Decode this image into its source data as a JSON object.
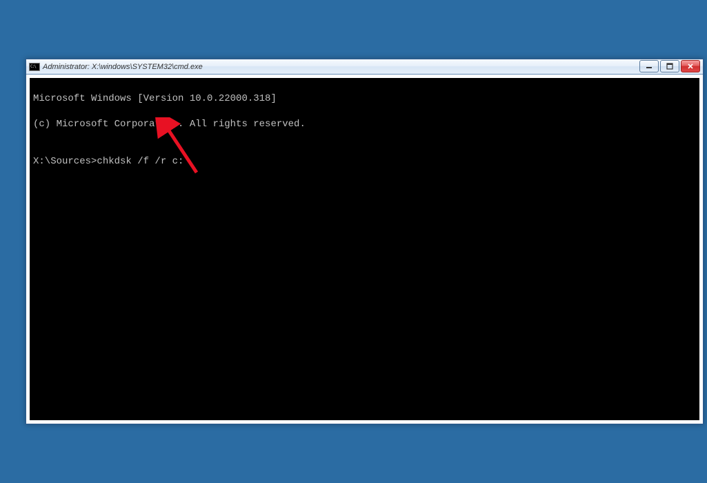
{
  "window": {
    "title": "Administrator: X:\\windows\\SYSTEM32\\cmd.exe"
  },
  "terminal": {
    "line1": "Microsoft Windows [Version 10.0.22000.318]",
    "line2": "(c) Microsoft Corporation. All rights reserved.",
    "blank": "",
    "prompt": "X:\\Sources>",
    "command": "chkdsk /f /r c:"
  }
}
